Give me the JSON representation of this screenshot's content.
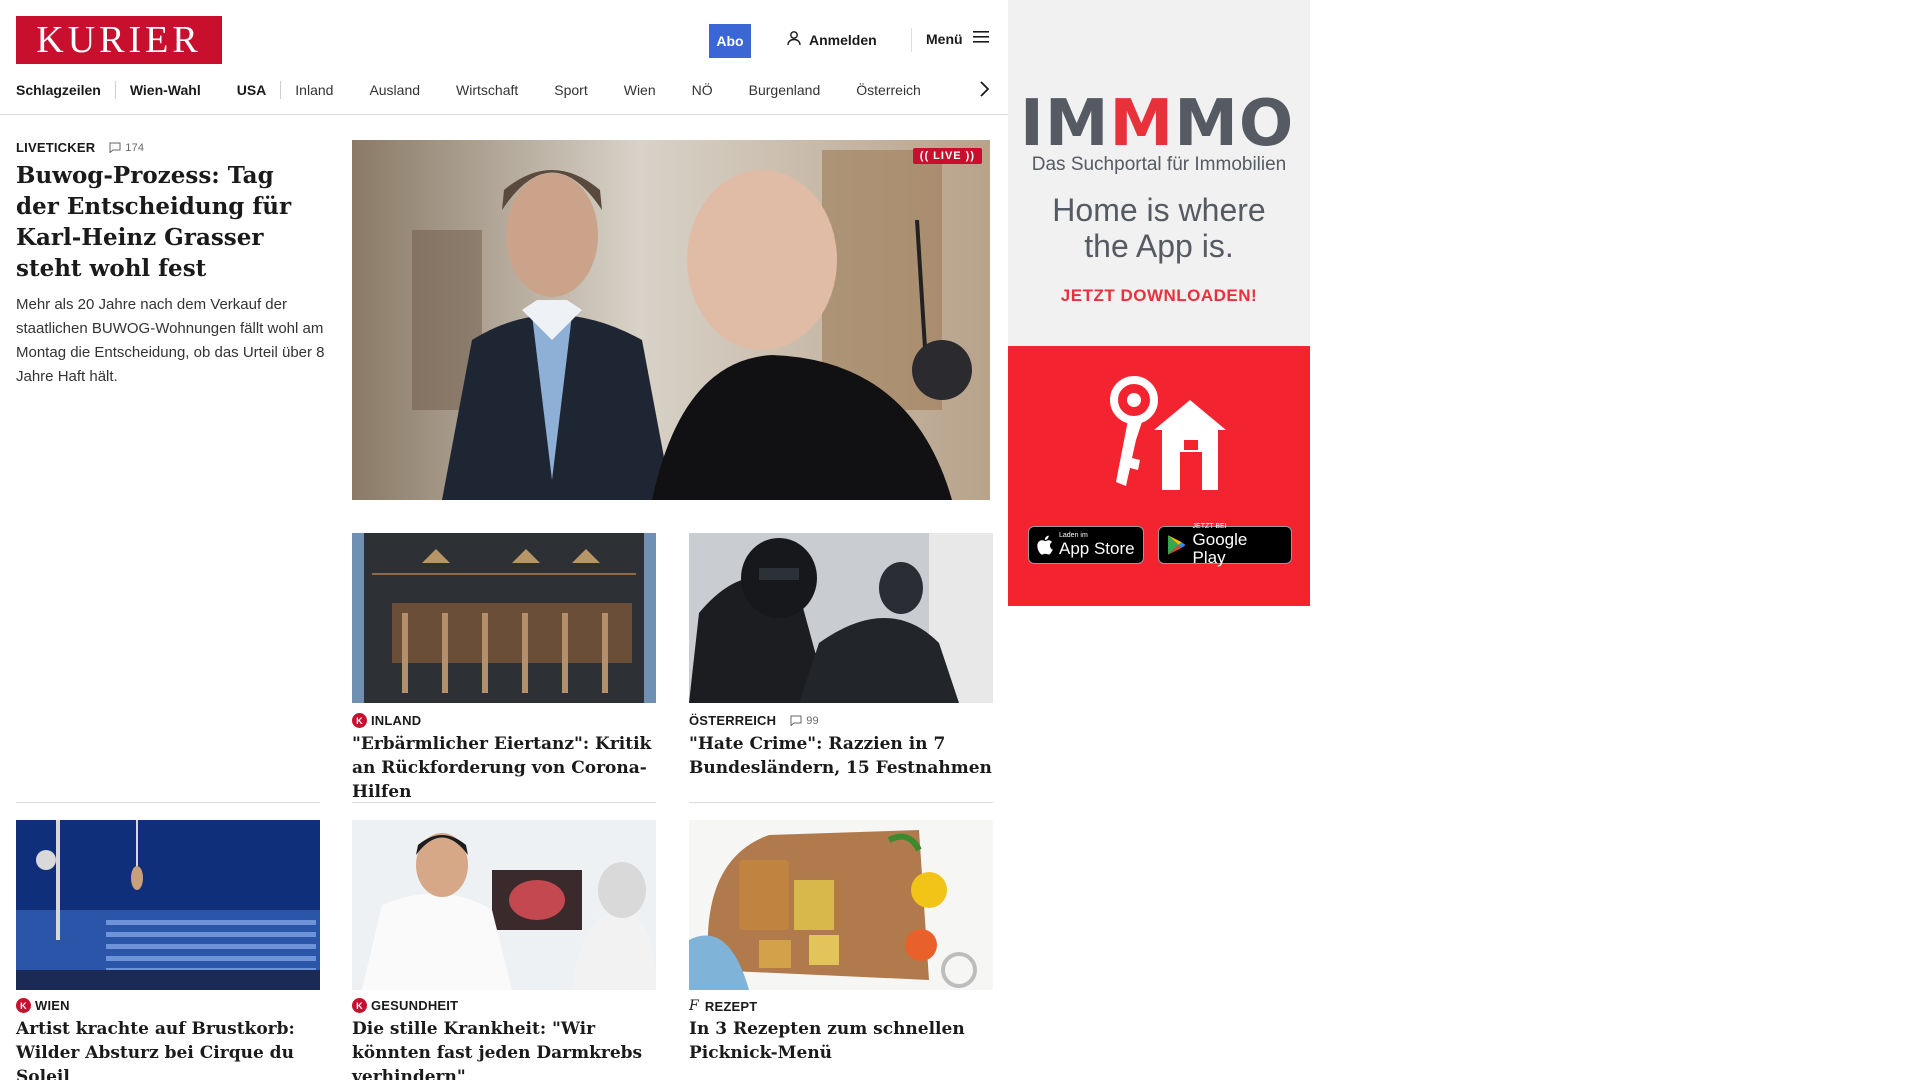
{
  "header": {
    "logo_text": "KURIER",
    "abo_label": "Abo",
    "login_label": "Anmelden",
    "menu_label": "Menü",
    "nav": [
      "Schlagzeilen",
      "Wien-Wahl",
      "USA",
      "Inland",
      "Ausland",
      "Wirtschaft",
      "Sport",
      "Wien",
      "NÖ",
      "Burgenland",
      "Österreich"
    ]
  },
  "lead": {
    "kicker": "LIVETICKER",
    "comments": "174",
    "headline": "Buwog-Prozess: Tag der Entscheidung für Karl-Heinz Grasser steht wohl fest",
    "teaser": "Mehr als 20 Jahre nach dem Verkauf der staatlichen BUWOG-Wohnungen fällt wohl am Montag die Entscheidung, ob das Urteil über 8 Jahre Haft hält.",
    "live_badge": "(( LIVE ))"
  },
  "cards": [
    {
      "kicker": "INLAND",
      "badge": "K",
      "comments": "",
      "headline": "\"Erbärmlicher Eiertanz\": Kritik an Rückforderung von Corona-Hilfen"
    },
    {
      "kicker": "ÖSTERREICH",
      "badge": "",
      "comments": "99",
      "headline": "\"Hate Crime\": Razzien in 7 Bundesländern, 15 Festnahmen"
    },
    {
      "kicker": "WIEN",
      "badge": "K",
      "comments": "",
      "headline": "Artist krachte auf Brustkorb: Wilder Absturz bei Cirque du Soleil"
    },
    {
      "kicker": "GESUNDHEIT",
      "badge": "K",
      "comments": "",
      "headline": "Die stille Krankheit: \"Wir könnten fast jeden Darmkrebs verhindern\""
    },
    {
      "kicker": "REZEPT",
      "badge": "f",
      "comments": "",
      "headline": "In 3 Rezepten zum schnellen Picknick-Menü"
    }
  ],
  "ad": {
    "brand_prefix": "IM",
    "brand_red": "M",
    "brand_suffix": "MO",
    "subtitle": "Das Suchportal für Immobilien",
    "claim_line1": "Home is where",
    "claim_line2": "the App is.",
    "cta": "JETZT DOWNLOADEN!",
    "appstore_small": "Laden im",
    "appstore_big": "App Store",
    "play_small": "JETZT BEI",
    "play_big": "Google Play"
  },
  "colors": {
    "brand_red": "#c8102e",
    "abo_blue": "#3a66d6",
    "ad_red": "#f3242f",
    "ad_grey": "#555a63"
  }
}
